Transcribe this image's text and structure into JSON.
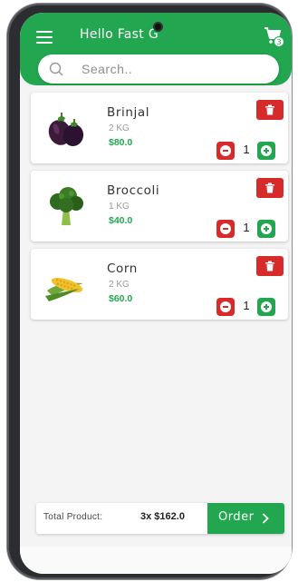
{
  "header": {
    "title": "Hello Fast G",
    "menu_icon": "hamburger-menu-icon",
    "cart_icon": "shopping-cart-icon",
    "cart_count": "3"
  },
  "search": {
    "placeholder": "Search..",
    "value": ""
  },
  "products": [
    {
      "name": "Brinjal",
      "weight": "2 KG",
      "price": "$80.0",
      "quantity": "1",
      "image": "eggplant"
    },
    {
      "name": "Broccoli",
      "weight": "1 KG",
      "price": "$40.0",
      "quantity": "1",
      "image": "broccoli"
    },
    {
      "name": "Corn",
      "weight": "2 KG",
      "price": "$60.0",
      "quantity": "1",
      "image": "corn"
    }
  ],
  "footer": {
    "total_label": "Total Product:",
    "total_value": "3x $162.0",
    "order_label": "Order"
  },
  "colors": {
    "primary_green": "#22a650",
    "delete_red": "#d72b2b"
  }
}
